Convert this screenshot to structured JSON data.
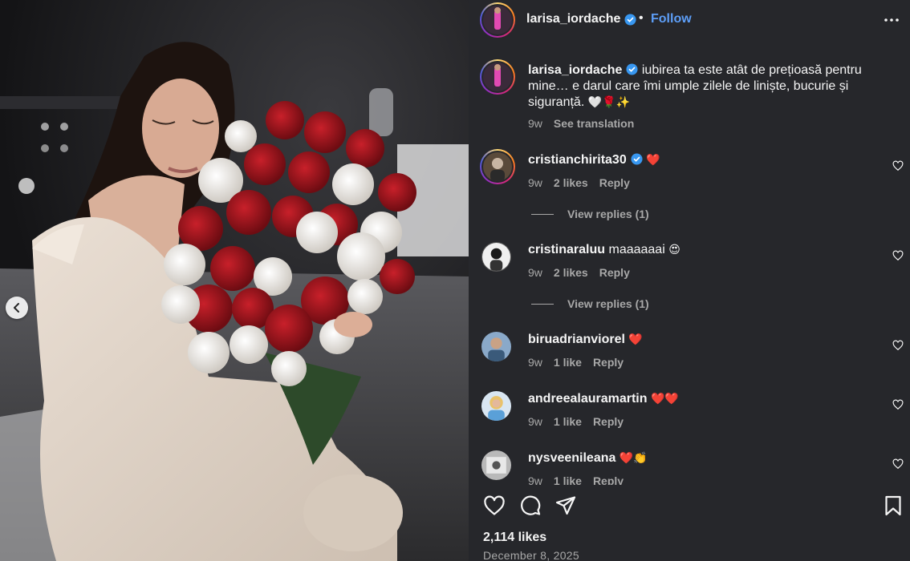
{
  "post": {
    "username": "larisa_iordache",
    "follow_label": "Follow",
    "dot": "•",
    "caption": "iubirea ta este atât de prețioasă pentru mine… e darul care îmi umple zilele de liniște, bucurie și siguranță.",
    "caption_emojis": "🤍🌹✨",
    "caption_time": "9w",
    "see_translation": "See translation"
  },
  "comments": [
    {
      "username": "cristianchirita30",
      "verified": true,
      "text": "",
      "emoji": "❤️",
      "time": "9w",
      "likes": "2 likes",
      "reply": "Reply",
      "replies": "View replies (1)"
    },
    {
      "username": "cristinaraluu",
      "verified": false,
      "text": "maaaaaai",
      "emoji": "😍",
      "time": "9w",
      "likes": "2 likes",
      "reply": "Reply",
      "replies": "View replies (1)"
    },
    {
      "username": "biruadrianviorel",
      "verified": false,
      "text": "",
      "emoji": "❤️",
      "time": "9w",
      "likes": "1 like",
      "reply": "Reply"
    },
    {
      "username": "andreealauramartin",
      "verified": false,
      "text": "",
      "emoji": "❤️❤️",
      "time": "9w",
      "likes": "1 like",
      "reply": "Reply"
    },
    {
      "username": "nysveenileana",
      "verified": false,
      "text": "",
      "emoji": "❤️👏",
      "time": "9w",
      "likes": "1 like",
      "reply": "Reply"
    }
  ],
  "footer": {
    "likes": "2,114 likes",
    "date": "December 8, 2025"
  },
  "colors": {
    "panel_bg": "#26272b",
    "link_blue": "#5d9ef7",
    "verified_blue": "#3897f0",
    "muted": "#a8a8a8"
  },
  "icons": [
    "chevron-left-icon",
    "verified-badge-icon",
    "more-horizontal-icon",
    "heart-icon",
    "comment-icon",
    "share-icon",
    "bookmark-icon"
  ]
}
